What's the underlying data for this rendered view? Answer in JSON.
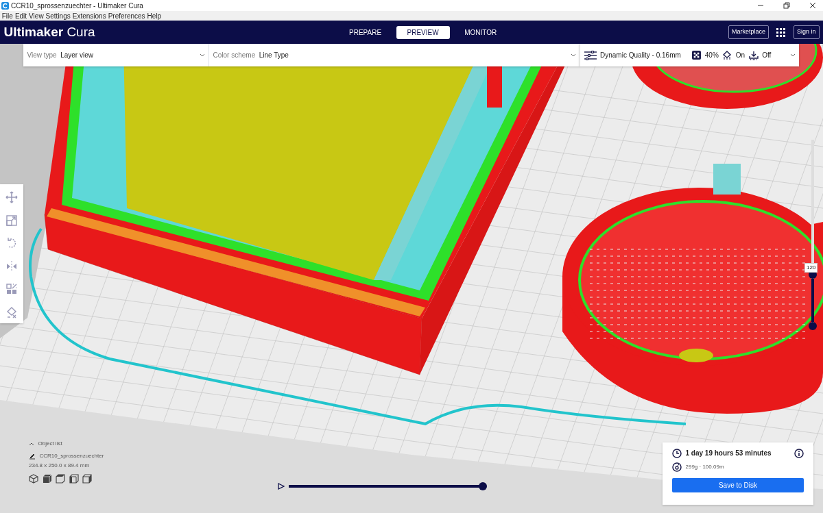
{
  "window": {
    "title": "CCR10_sprossenzuechter - Ultimaker Cura"
  },
  "menu": [
    {
      "label": "File"
    },
    {
      "label": "Edit"
    },
    {
      "label": "View"
    },
    {
      "label": "Settings"
    },
    {
      "label": "Extensions"
    },
    {
      "label": "Preferences"
    },
    {
      "label": "Help"
    }
  ],
  "header": {
    "logo_bold": "Ultimaker",
    "logo_light": "Cura",
    "marketplace": "Marketplace",
    "sign_in": "Sign in",
    "tabs": [
      {
        "label": "PREPARE",
        "selected": false
      },
      {
        "label": "PREVIEW",
        "selected": true
      },
      {
        "label": "MONITOR",
        "selected": false
      }
    ]
  },
  "view_bar": {
    "view_type_label": "View type",
    "view_type": "Layer view",
    "color_scheme_label": "Color scheme",
    "color_scheme": "Line Type"
  },
  "print_settings": {
    "profile": "Dynamic Quality - 0.16mm",
    "infill": "40%",
    "support": "On",
    "adhesion": "Off"
  },
  "tools": [
    {
      "kind": "move"
    },
    {
      "kind": "scale"
    },
    {
      "kind": "rotate"
    },
    {
      "kind": "mirror"
    },
    {
      "kind": "per-model"
    },
    {
      "kind": "support-blocker"
    }
  ],
  "layer_slider": {
    "reading": "120",
    "level": 0.28
  },
  "object_list": {
    "label": "Object list",
    "object_name": "CCR10_sprossenzuechter",
    "dimensions": "234.8 x 250.0 x 89.4 mm"
  },
  "camera_views": [
    {
      "kind": "perspective"
    },
    {
      "kind": "front"
    },
    {
      "kind": "top"
    },
    {
      "kind": "left"
    },
    {
      "kind": "right"
    }
  ],
  "simulation": {
    "level": 0.98
  },
  "print_info": {
    "time": "1 day 19 hours 53 minutes",
    "material": "299g · 100.09m",
    "button": "Save to Disk"
  }
}
